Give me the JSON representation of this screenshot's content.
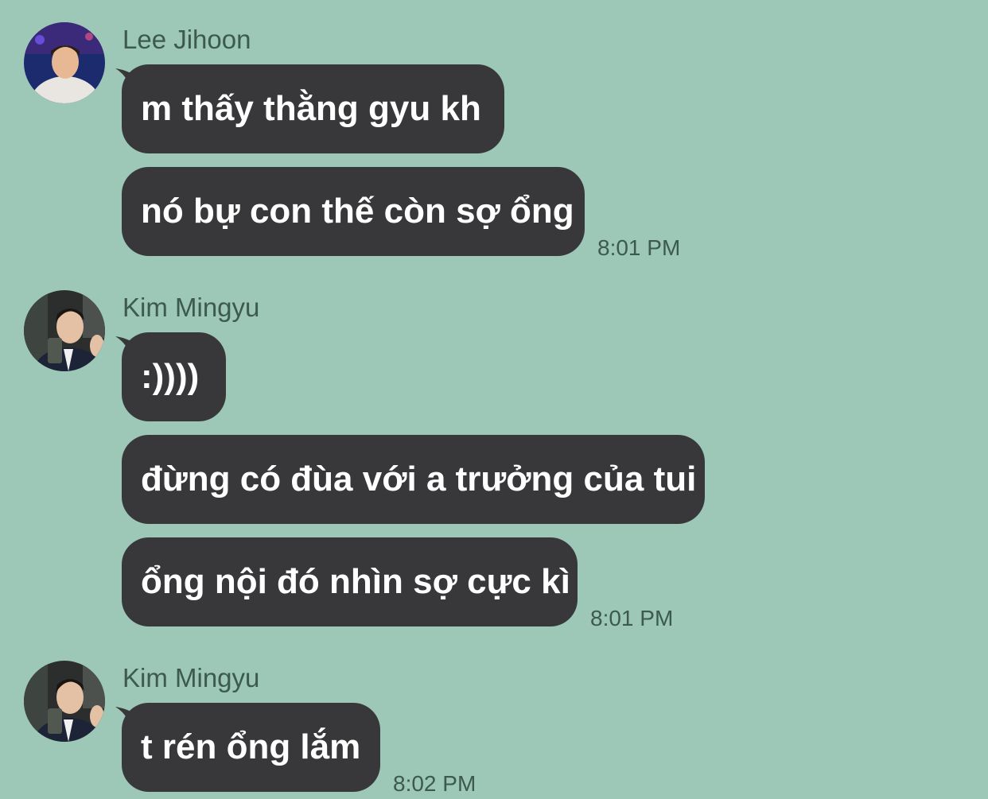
{
  "groups": [
    {
      "sender": "Lee Jihoon",
      "avatar_icon": "user-avatar-photo",
      "messages": [
        "m thấy thằng gyu kh",
        "nó bự con thế còn sợ ổng"
      ],
      "time": "8:01 PM"
    },
    {
      "sender": "Kim Mingyu",
      "avatar_icon": "user-avatar-photo",
      "messages": [
        ":))))",
        "đừng có đùa với a trưởng của tui",
        "ổng nội đó nhìn sợ cực kì"
      ],
      "time": "8:01 PM"
    },
    {
      "sender": "Kim Mingyu",
      "avatar_icon": "user-avatar-photo",
      "messages": [
        "t rén ổng lắm"
      ],
      "time": "8:02 PM"
    }
  ],
  "colors": {
    "background": "#9dc7b6",
    "bubble": "#38383b",
    "bubble_text": "#ffffff",
    "meta_text": "#3d5a4f"
  }
}
